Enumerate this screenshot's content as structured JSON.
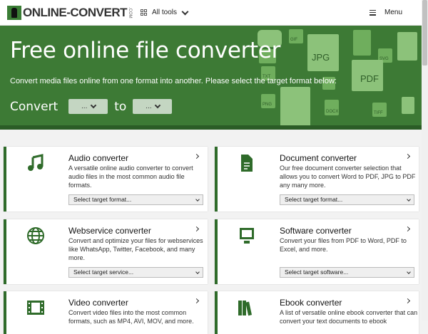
{
  "header": {
    "logo_text": "ONLINE-CONVERT",
    "logo_com": ".COM",
    "all_tools": "All tools",
    "menu": "Menu"
  },
  "hero": {
    "title": "Free online file converter",
    "subtitle": "Convert media files online from one format into another. Please select the target format below:",
    "convert_label": "Convert",
    "to_label": "to",
    "from_select": "...",
    "to_select": "...",
    "deco_labels": [
      "GIF",
      "JPG",
      "SVG",
      "TXT",
      "PDF",
      "PNG",
      "DOCX",
      "TIFF",
      "EPUB"
    ]
  },
  "cards": [
    {
      "title": "Audio converter",
      "desc": "A versatile online audio converter to convert audio files in the most common audio file formats.",
      "select": "Select target format...",
      "icon": "music-note-icon"
    },
    {
      "title": "Document converter",
      "desc": "Our free document converter selection that allows you to convert Word to PDF, JPG to PDF any many more.",
      "select": "Select target format...",
      "icon": "document-icon"
    },
    {
      "title": "Webservice converter",
      "desc": "Convert and optimize your files for webservices like WhatsApp, Twitter, Facebook, and many more.",
      "select": "Select target service...",
      "icon": "globe-icon"
    },
    {
      "title": "Software converter",
      "desc": "Convert your files from PDF to Word, PDF to Excel, and more.",
      "select": "Select target software...",
      "icon": "monitor-icon"
    },
    {
      "title": "Video converter",
      "desc": "Convert video files into the most common formats, such as MP4, AVI, MOV, and more.",
      "select": "",
      "icon": "film-icon"
    },
    {
      "title": "Ebook converter",
      "desc": "A list of versatile online ebook converter that can convert your text documents to ebook",
      "select": "",
      "icon": "books-icon"
    }
  ],
  "colors": {
    "brand": "#3d7a35",
    "accent_dark": "#2f6b2a",
    "icon": "#2f6b2a"
  }
}
